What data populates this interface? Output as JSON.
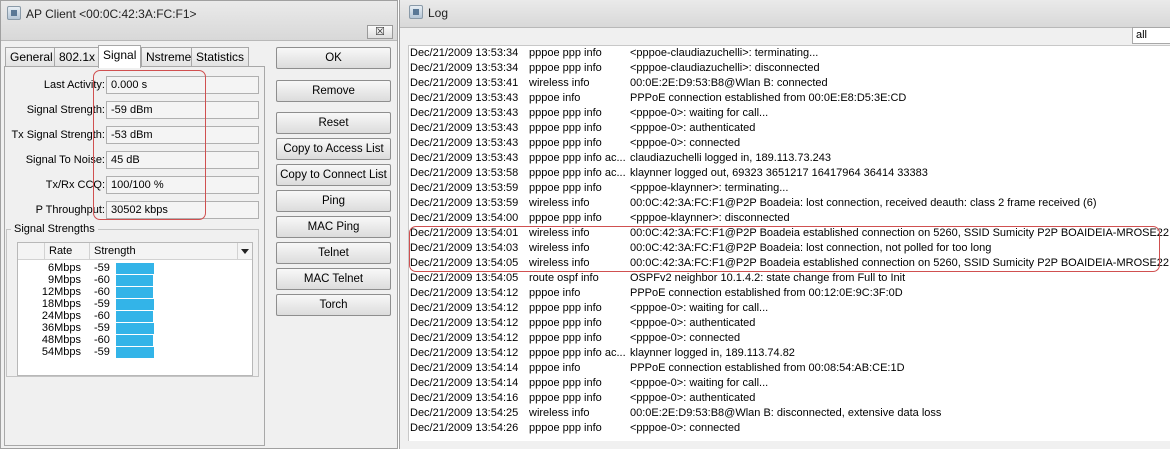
{
  "ap_window": {
    "title": "AP Client <00:0C:42:3A:FC:F1>",
    "close_label": "☒",
    "tabs": [
      {
        "label": "General"
      },
      {
        "label": "802.1x"
      },
      {
        "label": "Signal"
      },
      {
        "label": "Nstreme"
      },
      {
        "label": "Statistics"
      }
    ],
    "fields": [
      {
        "label": "Last Activity:",
        "value": "0.000 s"
      },
      {
        "label": "Signal Strength:",
        "value": "-59 dBm"
      },
      {
        "label": "Tx Signal Strength:",
        "value": "-53 dBm"
      },
      {
        "label": "Signal To Noise:",
        "value": "45 dB"
      },
      {
        "label": "Tx/Rx CCQ:",
        "value": "100/100 %"
      },
      {
        "label": "P Throughput:",
        "value": "30502 kbps"
      }
    ],
    "signal_strengths": {
      "title": "Signal Strengths",
      "columns": [
        "Rate",
        "Strength"
      ],
      "rows": [
        {
          "rate": "6Mbps",
          "strength": "-59",
          "level": -59
        },
        {
          "rate": "9Mbps",
          "strength": "-60",
          "level": -60
        },
        {
          "rate": "12Mbps",
          "strength": "-60",
          "level": -60
        },
        {
          "rate": "18Mbps",
          "strength": "-59",
          "level": -59
        },
        {
          "rate": "24Mbps",
          "strength": "-60",
          "level": -60
        },
        {
          "rate": "36Mbps",
          "strength": "-59",
          "level": -59
        },
        {
          "rate": "48Mbps",
          "strength": "-60",
          "level": -60
        },
        {
          "rate": "54Mbps",
          "strength": "-59",
          "level": -59
        }
      ]
    },
    "buttons": [
      {
        "label": "OK"
      },
      {
        "label": "Remove"
      },
      {
        "label": "Reset"
      },
      {
        "label": "Copy to Access List"
      },
      {
        "label": "Copy to Connect List"
      },
      {
        "label": "Ping"
      },
      {
        "label": "MAC Ping"
      },
      {
        "label": "Telnet"
      },
      {
        "label": "MAC Telnet"
      },
      {
        "label": "Torch"
      }
    ]
  },
  "log_window": {
    "title": "Log",
    "filter_value": "all",
    "rows": [
      {
        "time": "Dec/21/2009 13:53:34",
        "topic": "pppoe ppp info",
        "message": "<pppoe-claudiazuchelli>: terminating..."
      },
      {
        "time": "Dec/21/2009 13:53:34",
        "topic": "pppoe ppp info",
        "message": "<pppoe-claudiazuchelli>: disconnected"
      },
      {
        "time": "Dec/21/2009 13:53:41",
        "topic": "wireless info",
        "message": "00:0E:2E:D9:53:B8@Wlan B: connected"
      },
      {
        "time": "Dec/21/2009 13:53:43",
        "topic": "pppoe info",
        "message": "PPPoE connection established from 00:0E:E8:D5:3E:CD"
      },
      {
        "time": "Dec/21/2009 13:53:43",
        "topic": "pppoe ppp info",
        "message": "<pppoe-0>: waiting for call..."
      },
      {
        "time": "Dec/21/2009 13:53:43",
        "topic": "pppoe ppp info",
        "message": "<pppoe-0>: authenticated"
      },
      {
        "time": "Dec/21/2009 13:53:43",
        "topic": "pppoe ppp info",
        "message": "<pppoe-0>: connected"
      },
      {
        "time": "Dec/21/2009 13:53:43",
        "topic": "pppoe ppp info ac...",
        "message": "claudiazuchelli logged in, 189.113.73.243"
      },
      {
        "time": "Dec/21/2009 13:53:58",
        "topic": "pppoe ppp info ac...",
        "message": "klaynner logged out, 69323 3651217 16417964 36414 33383"
      },
      {
        "time": "Dec/21/2009 13:53:59",
        "topic": "pppoe ppp info",
        "message": "<pppoe-klaynner>: terminating..."
      },
      {
        "time": "Dec/21/2009 13:53:59",
        "topic": "wireless info",
        "message": "00:0C:42:3A:FC:F1@P2P Boadeia: lost connection, received deauth: class 2 frame received (6)"
      },
      {
        "time": "Dec/21/2009 13:54:00",
        "topic": "pppoe ppp info",
        "message": "<pppoe-klaynner>: disconnected"
      },
      {
        "time": "Dec/21/2009 13:54:01",
        "topic": "wireless info",
        "message": "00:0C:42:3A:FC:F1@P2P Boadeia established connection on 5260, SSID Sumicity P2P BOAIDEIA-MROSE22"
      },
      {
        "time": "Dec/21/2009 13:54:03",
        "topic": "wireless info",
        "message": "00:0C:42:3A:FC:F1@P2P Boadeia: lost connection, not polled for too long"
      },
      {
        "time": "Dec/21/2009 13:54:05",
        "topic": "wireless info",
        "message": "00:0C:42:3A:FC:F1@P2P Boadeia established connection on 5260, SSID Sumicity P2P BOAIDEIA-MROSE22"
      },
      {
        "time": "Dec/21/2009 13:54:05",
        "topic": "route ospf info",
        "message": "OSPFv2 neighbor 10.1.4.2: state change from Full to Init"
      },
      {
        "time": "Dec/21/2009 13:54:12",
        "topic": "pppoe info",
        "message": "PPPoE connection established from 00:12:0E:9C:3F:0D"
      },
      {
        "time": "Dec/21/2009 13:54:12",
        "topic": "pppoe ppp info",
        "message": "<pppoe-0>: waiting for call..."
      },
      {
        "time": "Dec/21/2009 13:54:12",
        "topic": "pppoe ppp info",
        "message": "<pppoe-0>: authenticated"
      },
      {
        "time": "Dec/21/2009 13:54:12",
        "topic": "pppoe ppp info",
        "message": "<pppoe-0>: connected"
      },
      {
        "time": "Dec/21/2009 13:54:12",
        "topic": "pppoe ppp info ac...",
        "message": "klaynner logged in, 189.113.74.82"
      },
      {
        "time": "Dec/21/2009 13:54:14",
        "topic": "pppoe info",
        "message": "PPPoE connection established from 00:08:54:AB:CE:1D"
      },
      {
        "time": "Dec/21/2009 13:54:14",
        "topic": "pppoe ppp info",
        "message": "<pppoe-0>: waiting for call..."
      },
      {
        "time": "Dec/21/2009 13:54:16",
        "topic": "pppoe ppp info",
        "message": "<pppoe-0>: authenticated"
      },
      {
        "time": "Dec/21/2009 13:54:25",
        "topic": "wireless info",
        "message": "00:0E:2E:D9:53:B8@Wlan B: disconnected, extensive data loss"
      },
      {
        "time": "Dec/21/2009 13:54:26",
        "topic": "pppoe ppp info",
        "message": "<pppoe-0>: connected"
      }
    ]
  },
  "colors": {
    "bar": "#33b4e8",
    "highlight": "#d05050"
  },
  "icons": {
    "ap_window": "app-window-icon",
    "log_window": "log-window-icon",
    "close": "close-icon",
    "dropdown": "chevron-down-icon"
  }
}
